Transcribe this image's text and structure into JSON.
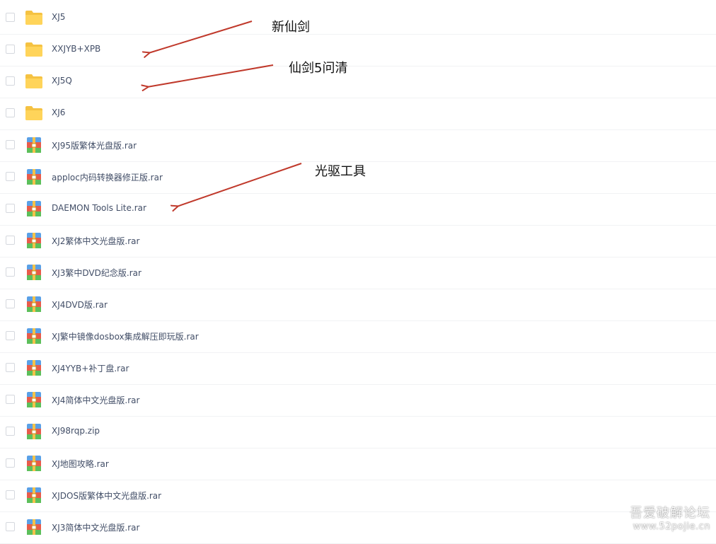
{
  "files": [
    {
      "name": "XJ5",
      "type": "folder"
    },
    {
      "name": "XXJYB+XPB",
      "type": "folder"
    },
    {
      "name": "XJ5Q",
      "type": "folder"
    },
    {
      "name": "XJ6",
      "type": "folder"
    },
    {
      "name": "XJ95版繁体光盘版.rar",
      "type": "archive"
    },
    {
      "name": "apploc内码转换器修正版.rar",
      "type": "archive"
    },
    {
      "name": "DAEMON Tools Lite.rar",
      "type": "archive"
    },
    {
      "name": "XJ2繁体中文光盘版.rar",
      "type": "archive"
    },
    {
      "name": "XJ3繁中DVD纪念版.rar",
      "type": "archive"
    },
    {
      "name": "XJ4DVD版.rar",
      "type": "archive"
    },
    {
      "name": "XJ繁中镜像dosbox集成解压即玩版.rar",
      "type": "archive"
    },
    {
      "name": "XJ4YYB+补丁盘.rar",
      "type": "archive"
    },
    {
      "name": "XJ4简体中文光盘版.rar",
      "type": "archive"
    },
    {
      "name": "XJ98rqp.zip",
      "type": "archive"
    },
    {
      "name": "XJ地图攻略.rar",
      "type": "archive"
    },
    {
      "name": "XJDOS版繁体中文光盘版.rar",
      "type": "archive"
    },
    {
      "name": "XJ3简体中文光盘版.rar",
      "type": "archive"
    }
  ],
  "annotations": [
    {
      "text": "新仙剑"
    },
    {
      "text": "仙剑5问清"
    },
    {
      "text": "光驱工具"
    }
  ],
  "watermark": {
    "line1": "吾爱破解论坛",
    "line2": "www.52pojie.cn"
  },
  "colors": {
    "folder": "#ffd45a",
    "arrow": "#c0392b"
  }
}
